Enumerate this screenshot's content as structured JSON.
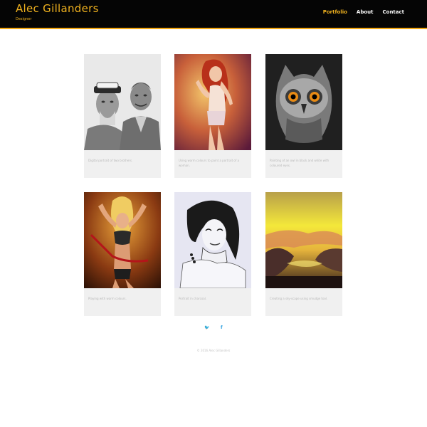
{
  "header": {
    "brand": "Alec Gillanders",
    "tagline": "Designer",
    "nav": [
      {
        "label": "Portfolio",
        "active": true
      },
      {
        "label": "About",
        "active": false
      },
      {
        "label": "Contact",
        "active": false
      }
    ]
  },
  "portfolio": [
    {
      "caption": "Digital portrait of two brothers.",
      "image": "pencil-portrait-two-men"
    },
    {
      "caption": "Using warm colours to paint a portrait of a woman.",
      "image": "painted-woman-red-hair"
    },
    {
      "caption": "Painting of an owl in black and white with coloured eyes.",
      "image": "owl-painting"
    },
    {
      "caption": "Playing with warm colours.",
      "image": "dancing-woman-warm"
    },
    {
      "caption": "Portrait in charcoal.",
      "image": "charcoal-portrait-woman"
    },
    {
      "caption": "Creating a sky-scape using smudge tool.",
      "image": "yellow-skyscape"
    }
  ],
  "footer": {
    "social": [
      "twitter-icon",
      "facebook-icon"
    ],
    "social_glyphs": {
      "twitter": "🐦",
      "facebook": "f"
    },
    "copyright": "© 2016 Alec Gillanders"
  },
  "colors": {
    "accent": "#f0b21f",
    "header_bg": "#050505",
    "card_bg": "#f0f0f0",
    "social": "#2b9fe0"
  }
}
